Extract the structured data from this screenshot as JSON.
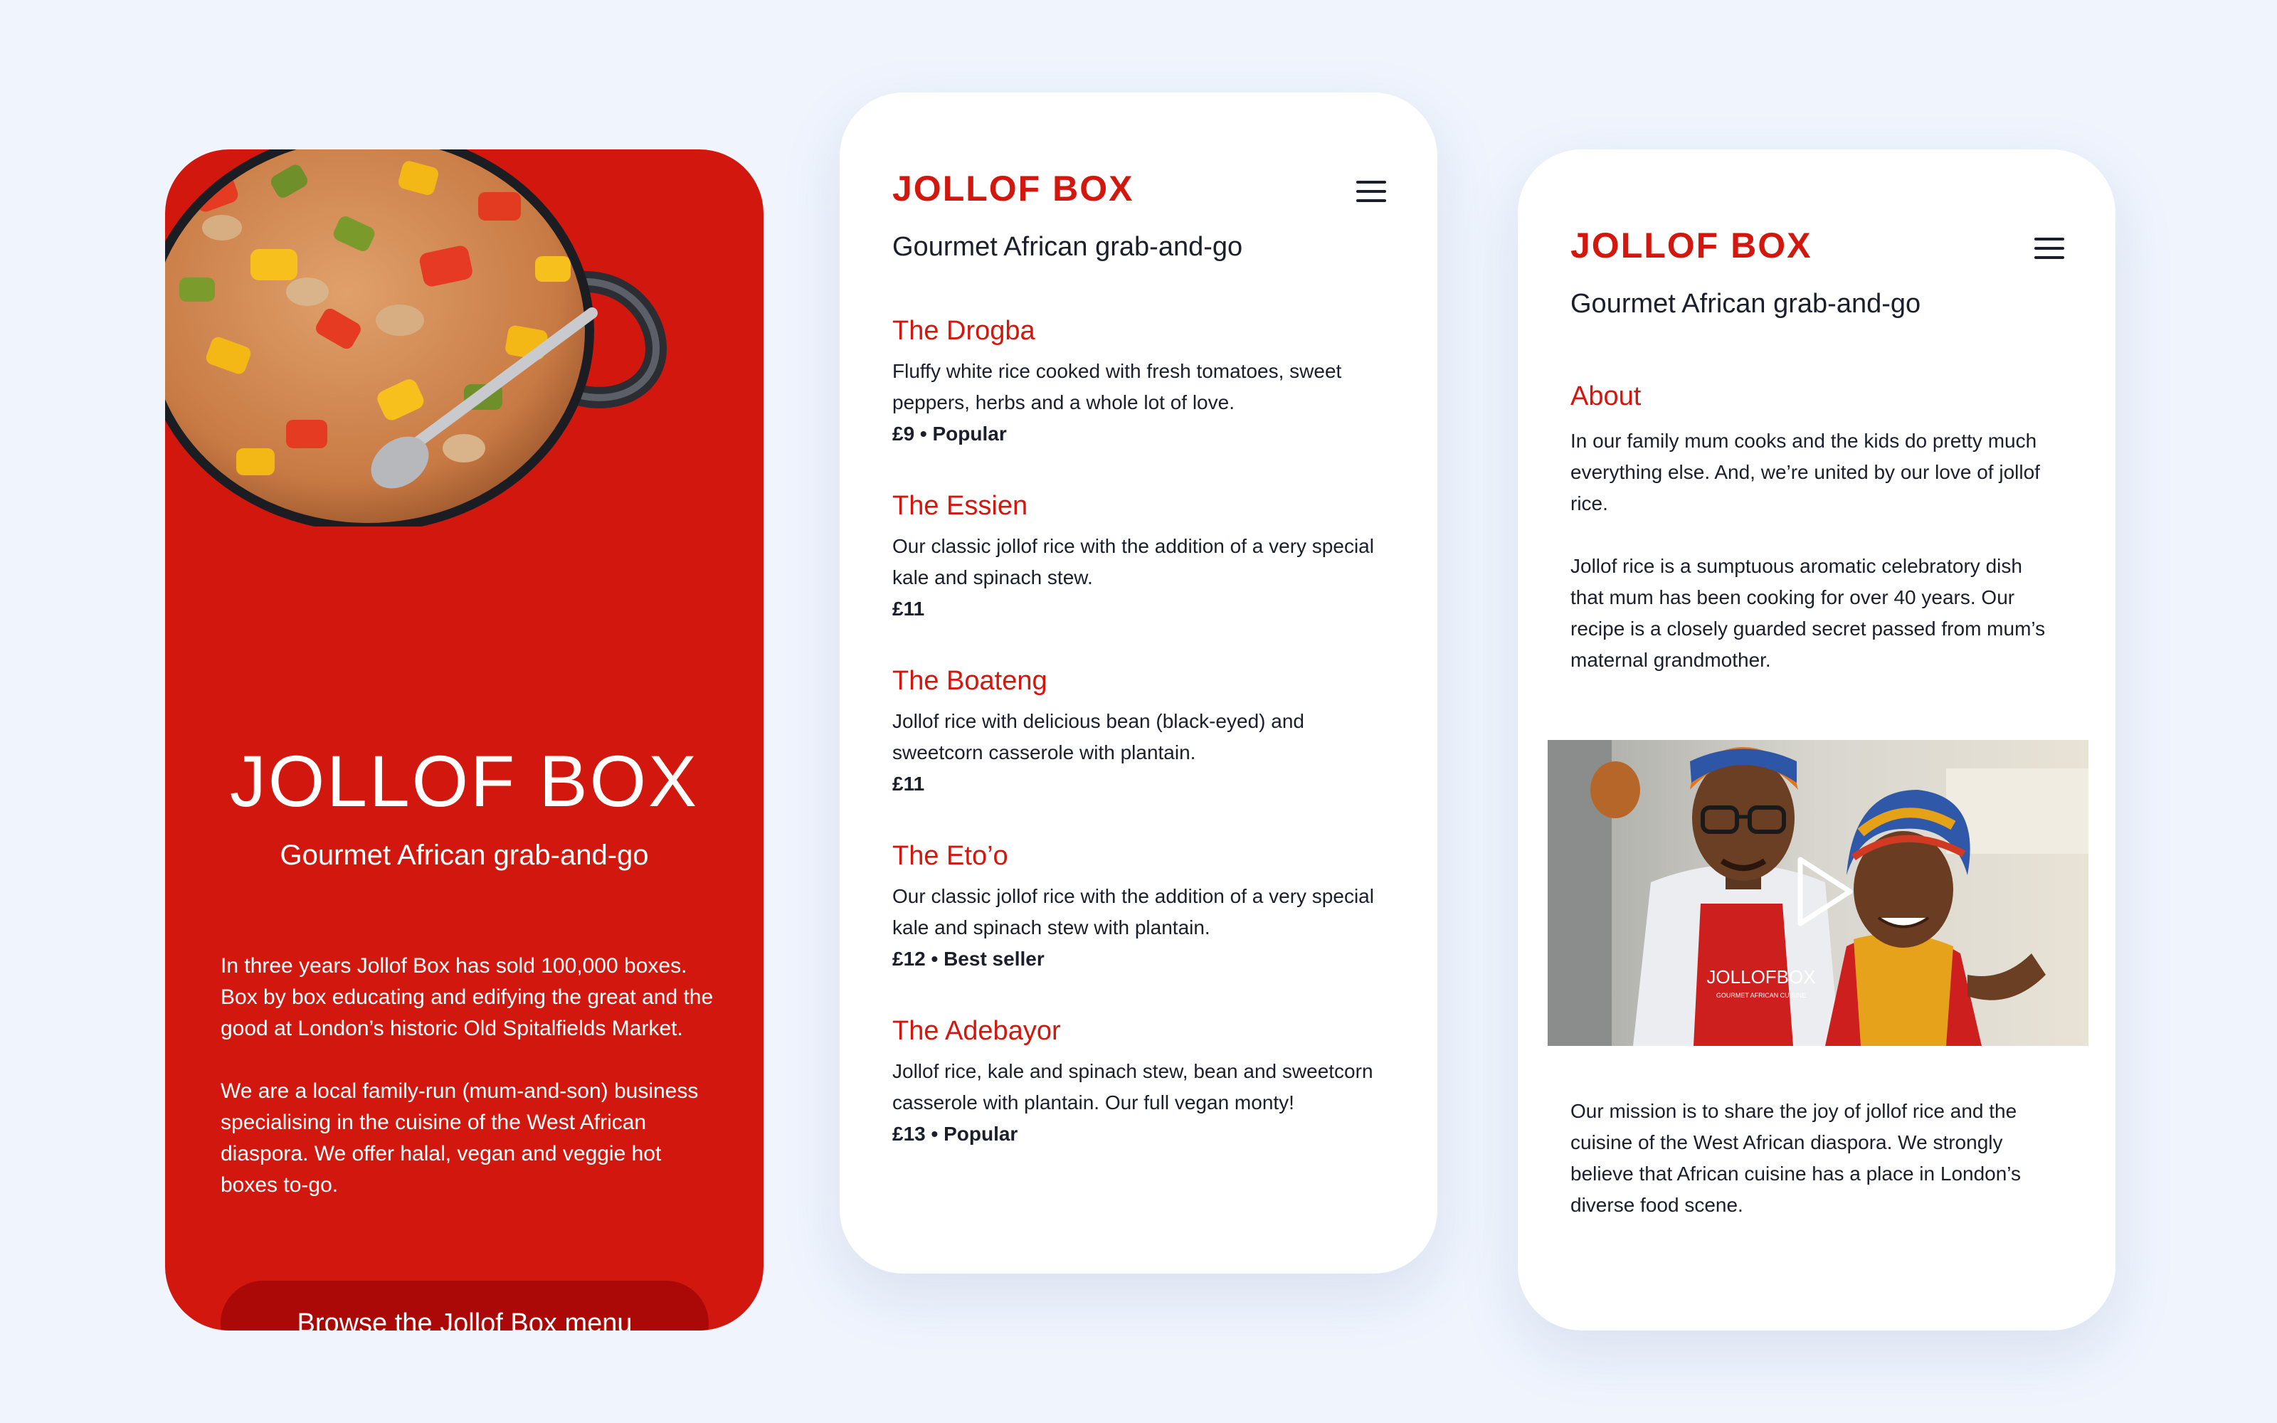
{
  "colors": {
    "brand_red": "#d2180e",
    "button_red": "#ab0808",
    "background": "#eff4fd",
    "text": "#1b1e2b"
  },
  "landing": {
    "hero_image_alt": "pan-of-jollof-rice",
    "title": "JOLLOF BOX",
    "tagline": "Gourmet African grab-and-go",
    "paragraph_1": "In three years Jollof Box has sold 100,000 boxes. Box by box educating and edifying the great and the good at London’s historic Old Spitalfields Market.",
    "paragraph_2": "We are a local family-run (mum-and-son) business specialising in the cuisine of the West African diaspora. We offer halal, vegan and veggie hot boxes to-go.",
    "cta_label": "Browse the Jollof Box menu"
  },
  "menu_page": {
    "logo": "JOLLOF BOX",
    "menu_icon": "hamburger-icon",
    "tagline": "Gourmet African grab-and-go",
    "items": [
      {
        "name": "The Drogba",
        "description": "Fluffy white rice cooked with fresh tomatoes, sweet peppers, herbs and a whole lot of love.",
        "meta": "£9 • Popular"
      },
      {
        "name": "The Essien",
        "description": "Our classic jollof rice with the addition of a very special kale and spinach stew.",
        "meta": "£11"
      },
      {
        "name": "The Boateng",
        "description": "Jollof rice with delicious bean (black-eyed) and sweetcorn casserole with plantain.",
        "meta": "£11"
      },
      {
        "name": "The Eto’o",
        "description": "Our classic jollof rice with the addition of a very special kale and spinach stew with plantain.",
        "meta": "£12 • Best seller"
      },
      {
        "name": "The Adebayor",
        "description": "Jollof rice, kale and spinach stew, bean and sweetcorn casserole with plantain. Our full vegan monty!",
        "meta": "£13 • Popular"
      }
    ]
  },
  "about_page": {
    "logo": "JOLLOF BOX",
    "menu_icon": "hamburger-icon",
    "tagline": "Gourmet African grab-and-go",
    "heading": "About",
    "paragraph_1": "In our family mum cooks and the kids do pretty much everything else. And, we’re united by our love of jollof rice.",
    "paragraph_2": "Jollof rice is a sumptuous aromatic celebratory dish that mum has been cooking for over 40 years. Our recipe is a closely guarded secret passed from mum’s maternal grandmother.",
    "video": {
      "apron_text": "JOLLOFBOX",
      "apron_subtext": "GOURMET AFRICAN CUISINE",
      "play_icon": "play-icon"
    },
    "paragraph_3": "Our mission is to share the joy of jollof rice and the cuisine of the West African diaspora. We strongly believe that African cuisine has a place in London’s diverse food scene."
  }
}
